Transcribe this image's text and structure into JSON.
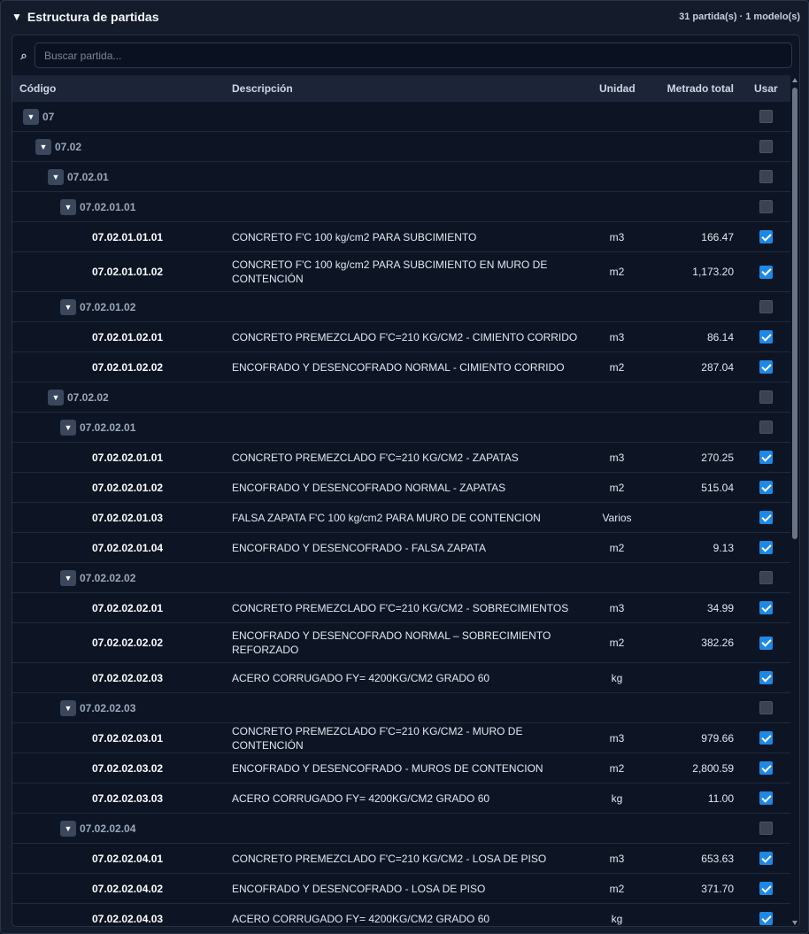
{
  "panel": {
    "title": "Estructura de partidas",
    "summary": "31 partida(s) · 1 modelo(s)"
  },
  "search": {
    "placeholder": "Buscar partida..."
  },
  "table": {
    "columns": {
      "code": "Código",
      "description": "Descripción",
      "unit": "Unidad",
      "quantity": "Metrado total",
      "use": "Usar"
    },
    "rows": [
      {
        "kind": "group",
        "level": 0,
        "code": "07",
        "checked": false
      },
      {
        "kind": "group",
        "level": 1,
        "code": "07.02",
        "checked": false
      },
      {
        "kind": "group",
        "level": 2,
        "code": "07.02.01",
        "checked": false
      },
      {
        "kind": "group",
        "level": 3,
        "code": "07.02.01.01",
        "checked": false
      },
      {
        "kind": "leaf",
        "code": "07.02.01.01.01",
        "description": "CONCRETO F'C 100 kg/cm2 PARA SUBCIMIENTO",
        "unit": "m3",
        "quantity": "166.47",
        "checked": true
      },
      {
        "kind": "leaf",
        "tall": true,
        "code": "07.02.01.01.02",
        "description": "CONCRETO F'C 100 kg/cm2 PARA SUBCIMIENTO EN MURO DE CONTENCIÓN",
        "unit": "m2",
        "quantity": "1,173.20",
        "checked": true
      },
      {
        "kind": "group",
        "level": 3,
        "code": "07.02.01.02",
        "checked": false
      },
      {
        "kind": "leaf",
        "code": "07.02.01.02.01",
        "description": "CONCRETO PREMEZCLADO F'C=210 KG/CM2 - CIMIENTO CORRIDO",
        "unit": "m3",
        "quantity": "86.14",
        "checked": true
      },
      {
        "kind": "leaf",
        "code": "07.02.01.02.02",
        "description": "ENCOFRADO Y DESENCOFRADO NORMAL - CIMIENTO CORRIDO",
        "unit": "m2",
        "quantity": "287.04",
        "checked": true
      },
      {
        "kind": "group",
        "level": 2,
        "code": "07.02.02",
        "checked": false
      },
      {
        "kind": "group",
        "level": 3,
        "code": "07.02.02.01",
        "checked": false
      },
      {
        "kind": "leaf",
        "code": "07.02.02.01.01",
        "description": "CONCRETO PREMEZCLADO F'C=210 KG/CM2 - ZAPATAS",
        "unit": "m3",
        "quantity": "270.25",
        "checked": true
      },
      {
        "kind": "leaf",
        "code": "07.02.02.01.02",
        "description": "ENCOFRADO Y DESENCOFRADO NORMAL - ZAPATAS",
        "unit": "m2",
        "quantity": "515.04",
        "checked": true
      },
      {
        "kind": "leaf",
        "code": "07.02.02.01.03",
        "description": "FALSA ZAPATA F'C 100 kg/cm2 PARA MURO DE CONTENCION",
        "unit": "Varios",
        "quantity": "",
        "checked": true
      },
      {
        "kind": "leaf",
        "code": "07.02.02.01.04",
        "description": "ENCOFRADO Y DESENCOFRADO - FALSA ZAPATA",
        "unit": "m2",
        "quantity": "9.13",
        "checked": true
      },
      {
        "kind": "group",
        "level": 3,
        "code": "07.02.02.02",
        "checked": false
      },
      {
        "kind": "leaf",
        "code": "07.02.02.02.01",
        "description": "CONCRETO PREMEZCLADO F'C=210 KG/CM2 - SOBRECIMIENTOS",
        "unit": "m3",
        "quantity": "34.99",
        "checked": true
      },
      {
        "kind": "leaf",
        "tall": true,
        "code": "07.02.02.02.02",
        "description": "ENCOFRADO Y DESENCOFRADO NORMAL – SOBRECIMIENTO REFORZADO",
        "unit": "m2",
        "quantity": "382.26",
        "checked": true
      },
      {
        "kind": "leaf",
        "code": "07.02.02.02.03",
        "description": "ACERO CORRUGADO FY= 4200KG/CM2 GRADO 60",
        "unit": "kg",
        "quantity": "",
        "checked": true
      },
      {
        "kind": "group",
        "level": 3,
        "code": "07.02.02.03",
        "checked": false
      },
      {
        "kind": "leaf",
        "code": "07.02.02.03.01",
        "description": "CONCRETO PREMEZCLADO F'C=210 KG/CM2 - MURO DE CONTENCIÓN",
        "unit": "m3",
        "quantity": "979.66",
        "checked": true
      },
      {
        "kind": "leaf",
        "code": "07.02.02.03.02",
        "description": "ENCOFRADO Y DESENCOFRADO - MUROS DE CONTENCION",
        "unit": "m2",
        "quantity": "2,800.59",
        "checked": true
      },
      {
        "kind": "leaf",
        "code": "07.02.02.03.03",
        "description": "ACERO CORRUGADO FY= 4200KG/CM2 GRADO 60",
        "unit": "kg",
        "quantity": "11.00",
        "checked": true
      },
      {
        "kind": "group",
        "level": 3,
        "code": "07.02.02.04",
        "checked": false
      },
      {
        "kind": "leaf",
        "code": "07.02.02.04.01",
        "description": "CONCRETO PREMEZCLADO F'C=210 KG/CM2 - LOSA DE PISO",
        "unit": "m3",
        "quantity": "653.63",
        "checked": true
      },
      {
        "kind": "leaf",
        "code": "07.02.02.04.02",
        "description": "ENCOFRADO Y DESENCOFRADO - LOSA DE PISO",
        "unit": "m2",
        "quantity": "371.70",
        "checked": true
      },
      {
        "kind": "leaf",
        "code": "07.02.02.04.03",
        "description": "ACERO CORRUGADO FY= 4200KG/CM2 GRADO 60",
        "unit": "kg",
        "quantity": "",
        "checked": true
      }
    ]
  }
}
